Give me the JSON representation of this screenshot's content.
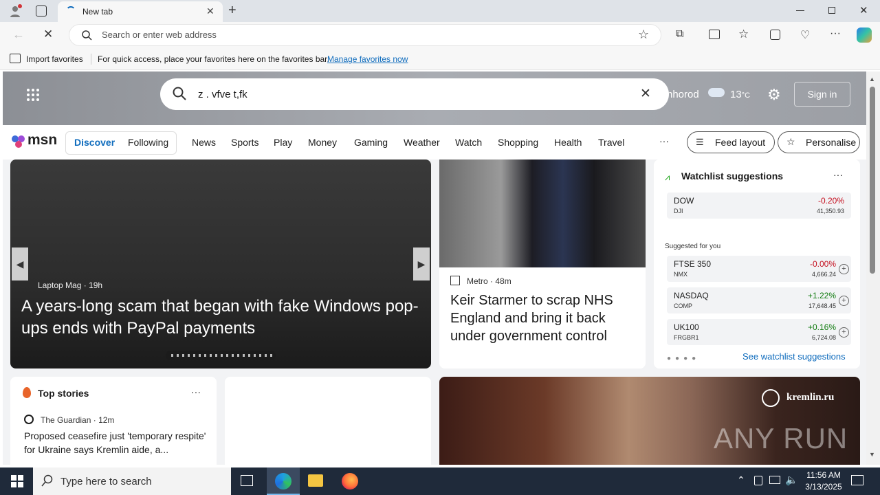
{
  "browser": {
    "tab_title": "New tab",
    "address_placeholder": "Search or enter web address",
    "favorites": {
      "import_label": "Import favorites",
      "hint": "For quick access, place your favorites here on the favorites bar.",
      "manage_link": "Manage favorites now"
    }
  },
  "msn": {
    "search_value": "z . vfve t,fk",
    "location_partial": "nhorod",
    "temperature": "13",
    "temp_unit": "°C",
    "sign_in": "Sign in",
    "logo_text": "msn",
    "tabs": [
      "Discover",
      "Following"
    ],
    "nav": [
      "News",
      "Sports",
      "Play",
      "Money",
      "Gaming",
      "Weather",
      "Watch",
      "Shopping",
      "Health",
      "Travel"
    ],
    "more": "···",
    "feed_layout": "Feed layout",
    "personalise": "Personalise",
    "hero_story": {
      "source": "Laptop Mag",
      "age": "19h",
      "headline": "A years-long scam that began with fake Windows pop-ups ends with PayPal payments"
    },
    "side_story": {
      "source": "Metro",
      "age": "48m",
      "headline": "Keir Starmer to scrap NHS England and bring it back under government control"
    },
    "watchlist": {
      "title": "Watchlist suggestions",
      "main": {
        "name": "DOW",
        "symbol": "DJI",
        "change": "-0.20%",
        "value": "41,350.93"
      },
      "suggested_label": "Suggested for you",
      "items": [
        {
          "name": "FTSE 350",
          "symbol": "NMX",
          "change": "-0.00%",
          "value": "4,666.24"
        },
        {
          "name": "NASDAQ",
          "symbol": "COMP",
          "change": "+1.22%",
          "value": "17,648.45"
        },
        {
          "name": "UK100",
          "symbol": "FRGBR1",
          "change": "+0.16%",
          "value": "6,724.08"
        }
      ],
      "link": "See watchlist suggestions"
    },
    "top_stories": {
      "title": "Top stories",
      "source": "The Guardian",
      "age": "12m",
      "headline": "Proposed ceasefire just 'temporary respite' for Ukraine says Kremlin aide, a..."
    },
    "photo_watermark": "kremlin.ru",
    "overlay_watermark": "ANY RUN"
  },
  "taskbar": {
    "search_placeholder": "Type here to search",
    "time": "11:56 AM",
    "date": "3/13/2025"
  },
  "colors": {
    "accent": "#0f6cbd",
    "negative": "#c50f1f",
    "positive": "#0e7a0d",
    "taskbar": "#1f2a3a"
  }
}
